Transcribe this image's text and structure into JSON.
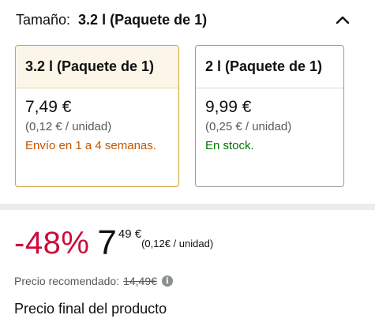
{
  "size_selector": {
    "label": "Tamaño:",
    "selected_value": "3.2 l (Paquete de 1)",
    "collapse_icon": "chevron-up-icon"
  },
  "options": [
    {
      "name": "3.2 l (Paquete de 1)",
      "price": "7,49 €",
      "unit_price": "(0,12 € / unidad)",
      "shipping": "Envío en 1 a 4 semanas.",
      "selected": true
    },
    {
      "name": "2 l (Paquete de 1)",
      "price": "9,99 €",
      "unit_price": "(0,25 € / unidad)",
      "shipping": "En stock.",
      "selected": false
    }
  ],
  "price": {
    "discount": "-48%",
    "whole": "7",
    "fraction": "49 €",
    "unit_price": "(0,12€ / unidad)"
  },
  "rrp": {
    "label": "Precio recomendado:",
    "value": "14,49€",
    "info_icon": "info-icon"
  },
  "final_price_label": "Precio final del producto",
  "colors": {
    "discount": "#cc0c39",
    "selected_border": "#d1a33a",
    "shipping_delay": "#c45500",
    "in_stock": "#007600"
  }
}
